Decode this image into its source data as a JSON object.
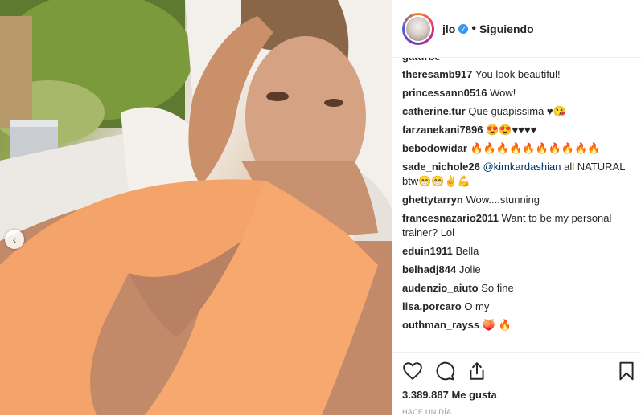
{
  "post": {
    "username": "jlo",
    "verified_mark": "✓",
    "separator": "•",
    "follow_status": "Siguiendo",
    "carousel_prev_glyph": "‹"
  },
  "comments": {
    "partial_row": "gaturbe",
    "items": [
      {
        "user": "theresamb917",
        "text": "You look beautiful!"
      },
      {
        "user": "princessann0516",
        "text": "Wow!"
      },
      {
        "user": "catherine.tur",
        "text": "Que guapissima ♥😘"
      },
      {
        "user": "farzanekani7896",
        "text": "😍😍♥♥♥♥"
      },
      {
        "user": "bebodowidar",
        "text": "🔥🔥🔥🔥🔥🔥🔥🔥🔥🔥"
      },
      {
        "user": "sade_nichole26",
        "mention": "@kimkardashian",
        "text": "all NATURAL btw😁😁✌💪"
      },
      {
        "user": "ghettytarryn",
        "text": "Wow....stunning"
      },
      {
        "user": "francesnazario2011",
        "text": "Want to be my personal trainer? Lol"
      },
      {
        "user": "eduin1911",
        "text": "Bella"
      },
      {
        "user": "belhadj844",
        "text": "Jolie"
      },
      {
        "user": "audenzio_aiuto",
        "text": "So fine"
      },
      {
        "user": "lisa.porcaro",
        "text": "O my"
      },
      {
        "user": "outhman_rayss",
        "text": "🍑 🔥"
      }
    ]
  },
  "actions": {
    "like_icon": "heart-icon",
    "comment_icon": "comment-icon",
    "share_icon": "share-icon",
    "save_icon": "bookmark-icon"
  },
  "stats": {
    "likes": "3.389.887 Me gusta",
    "time": "HACE UN DÍA"
  },
  "colors": {
    "verified": "#3897f0",
    "text": "#262626",
    "muted": "#999999",
    "mention": "#003569"
  }
}
